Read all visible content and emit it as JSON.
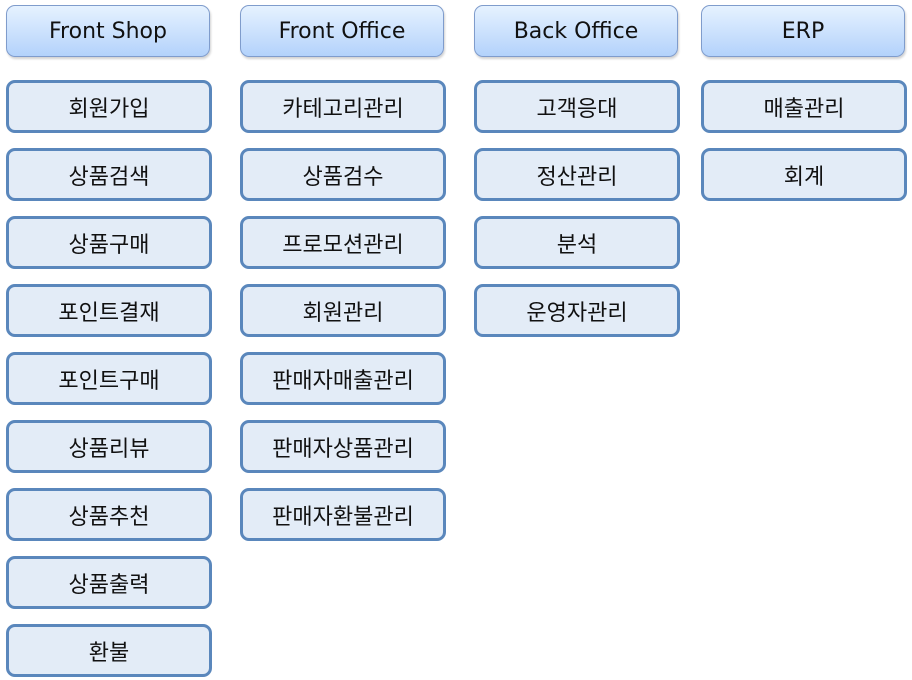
{
  "columns": [
    {
      "title": "Front Shop",
      "items": [
        "회원가입",
        "상품검색",
        "상품구매",
        "포인트결재",
        "포인트구매",
        "상품리뷰",
        "상품추천",
        "상품출력",
        "환불"
      ]
    },
    {
      "title": "Front Office",
      "items": [
        "카테고리관리",
        "상품검수",
        "프로모션관리",
        "회원관리",
        "판매자매출관리",
        "판매자상품관리",
        "판매자환불관리"
      ]
    },
    {
      "title": "Back Office",
      "items": [
        "고객응대",
        "정산관리",
        "분석",
        "운영자관리"
      ]
    },
    {
      "title": "ERP",
      "items": [
        "매출관리",
        "회계"
      ]
    }
  ],
  "colors": {
    "header_top": "#e6f2ff",
    "header_bottom": "#b3d2fb",
    "box_fill": "#e3ecf7",
    "box_border": "#5a87bc"
  }
}
